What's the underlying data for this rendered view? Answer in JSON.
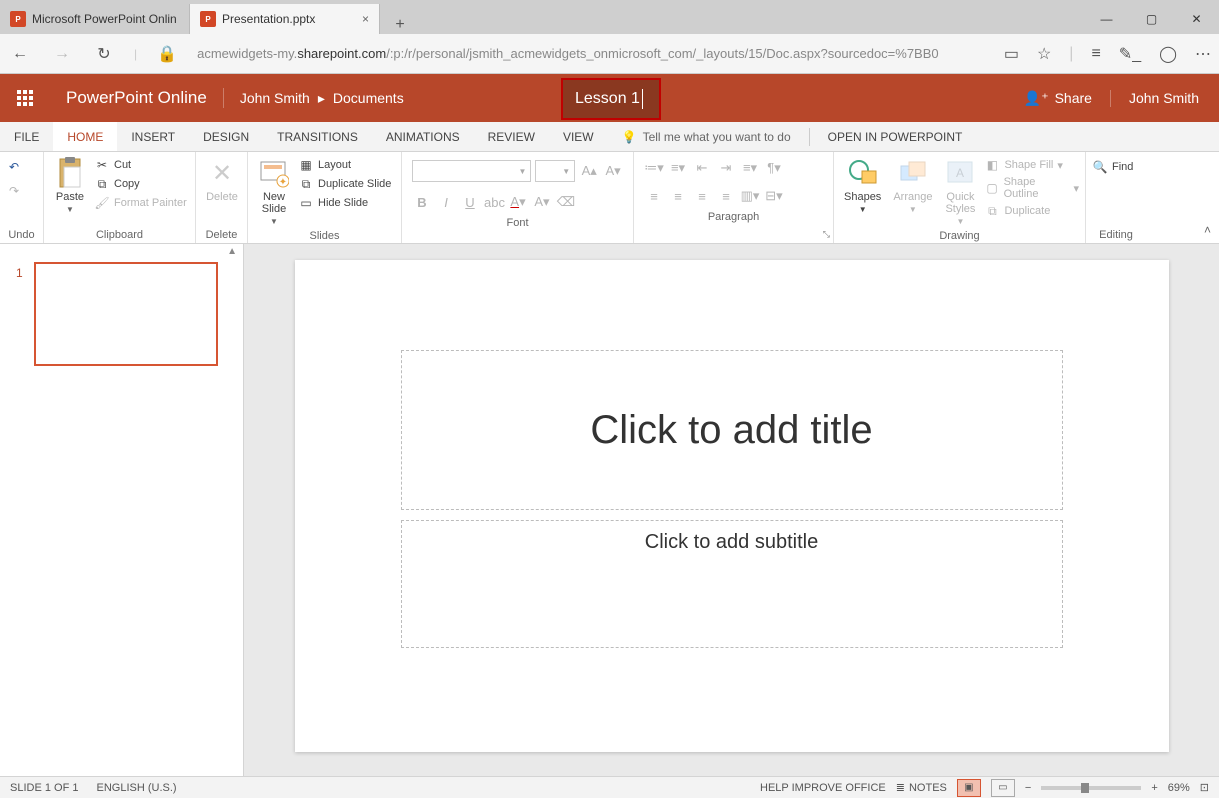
{
  "browser": {
    "tab1": "Microsoft PowerPoint Onlin",
    "tab2": "Presentation.pptx",
    "url_pre": "acmewidgets-my.",
    "url_dark": "sharepoint.com",
    "url_post": "/:p:/r/personal/jsmith_acmewidgets_onmicrosoft_com/_layouts/15/Doc.aspx?sourcedoc=%7BB0"
  },
  "app": {
    "name": "PowerPoint Online",
    "user": "John Smith",
    "crumb2": "Documents",
    "doc_title": "Lesson 1",
    "share": "Share",
    "user_right": "John Smith"
  },
  "tabs": {
    "file": "FILE",
    "home": "HOME",
    "insert": "INSERT",
    "design": "DESIGN",
    "trans": "TRANSITIONS",
    "anim": "ANIMATIONS",
    "review": "REVIEW",
    "view": "VIEW",
    "tellme": "Tell me what you want to do",
    "openin": "OPEN IN POWERPOINT"
  },
  "ribbon": {
    "undo": "Undo",
    "paste": "Paste",
    "cut": "Cut",
    "copy": "Copy",
    "fmt": "Format Painter",
    "clipboard": "Clipboard",
    "delete": "Delete",
    "delete_g": "Delete",
    "newslide": "New Slide",
    "layout": "Layout",
    "dup": "Duplicate Slide",
    "hide": "Hide Slide",
    "slides": "Slides",
    "font": "Font",
    "para": "Paragraph",
    "shapes": "Shapes",
    "arrange": "Arrange",
    "quick": "Quick Styles",
    "sfill": "Shape Fill",
    "soutline": "Shape Outline",
    "sdup": "Duplicate",
    "drawing": "Drawing",
    "find": "Find",
    "editing": "Editing"
  },
  "slide": {
    "num": "1",
    "title_ph": "Click to add title",
    "sub_ph": "Click to add subtitle"
  },
  "status": {
    "slideof": "SLIDE 1 OF 1",
    "lang": "ENGLISH (U.S.)",
    "help": "HELP IMPROVE OFFICE",
    "notes": "NOTES",
    "zoom": "69%"
  }
}
